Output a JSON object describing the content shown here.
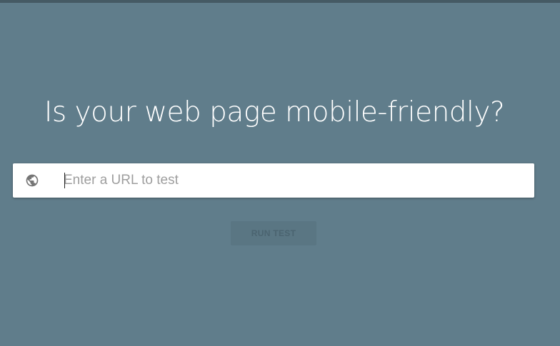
{
  "headline": "Is your web page mobile-friendly?",
  "url_field": {
    "placeholder": "Enter a URL to test",
    "value": "",
    "icon": "globe-icon"
  },
  "run_button": {
    "label": "RUN TEST",
    "state": "disabled"
  },
  "colors": {
    "background": "#607d8b",
    "top_bar": "#455a64",
    "input_background": "#ffffff",
    "button_background": "#5a7683",
    "button_text": "#4b6470"
  }
}
